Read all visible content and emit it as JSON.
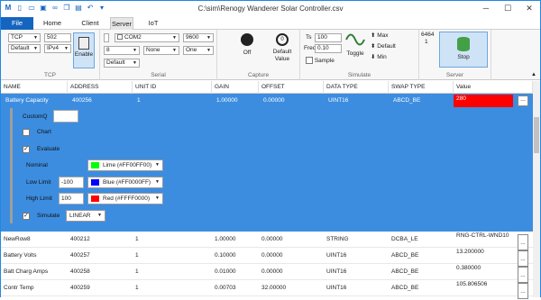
{
  "window": {
    "title": "C:\\sim\\Renogy Wanderer Solar Controller.csv"
  },
  "tabs": [
    {
      "label": "File"
    },
    {
      "label": "Home"
    },
    {
      "label": "Client"
    },
    {
      "label": "Server"
    },
    {
      "label": "IoT"
    }
  ],
  "tcp": {
    "protocol": "TCP",
    "port": "502",
    "mode": "Default",
    "ip": "IPv4",
    "enable": "Enable",
    "group": "TCP"
  },
  "serial": {
    "com": "COM2",
    "baud": "9600",
    "bits": "8",
    "parity": "None",
    "stop": "One",
    "flow": "Default",
    "group": "Serial"
  },
  "capture": {
    "off": "Off",
    "default_value": "Default\nValue",
    "group": "Capture"
  },
  "simulate": {
    "ts_label": "Ts",
    "ts": "100",
    "freq_label": "Freq",
    "freq": "0.10",
    "sample": "Sample",
    "toggle": "Toggle",
    "max": "Max",
    "default": "Default",
    "min": "Min",
    "group": "Simulate"
  },
  "server": {
    "count_top": "6464",
    "count_bottom": "1",
    "stop": "Stop",
    "group": "Server"
  },
  "grid": {
    "headers": [
      "NAME",
      "ADDRESS",
      "UNIT ID",
      "GAIN",
      "OFFSET",
      "DATA TYPE",
      "SWAP TYPE",
      "Value"
    ],
    "selected": {
      "name": "Battery Capacity",
      "address": "400256",
      "unit": "1",
      "gain": "1.00000",
      "offset": "0.00000",
      "dtype": "UINT16",
      "swap": "ABCD_BE",
      "value": "280",
      "edit": "..."
    },
    "detail": {
      "customq": "CustomQ",
      "chart": "Chart",
      "evaluate": "Evaluate",
      "nominal": "Nominal",
      "nominal_color": "Lime (#FF00FF00)",
      "low": "Low Limit",
      "low_val": "-100",
      "low_color": "Blue (#FF0000FF)",
      "high": "High Limit",
      "high_val": "100",
      "high_color": "Red (#FFFF0000)",
      "simulate": "Simulate",
      "sim_mode": "LINEAR"
    },
    "rows": [
      {
        "name": "NewRow8",
        "address": "400212",
        "unit": "1",
        "gain": "1.00000",
        "offset": "0.00000",
        "dtype": "STRING",
        "swap": "DCBA_LE",
        "value": "RNG-CTRL-WND10",
        "edit": "..."
      },
      {
        "name": "Battery Volts",
        "address": "400257",
        "unit": "1",
        "gain": "0.10000",
        "offset": "0.00000",
        "dtype": "UINT16",
        "swap": "ABCD_BE",
        "value": "13.200000",
        "edit": "..."
      },
      {
        "name": "Batt Charg Amps",
        "address": "400258",
        "unit": "1",
        "gain": "0.01000",
        "offset": "0.00000",
        "dtype": "UINT16",
        "swap": "ABCD_BE",
        "value": "0.380000",
        "edit": "..."
      },
      {
        "name": "Contr Temp",
        "address": "400259",
        "unit": "1",
        "gain": "0.00703",
        "offset": "32.00000",
        "dtype": "UINT16",
        "swap": "ABCD_BE",
        "value": "105.806506",
        "edit": "..."
      }
    ]
  },
  "colors": {
    "accent": "#1565c0",
    "selection": "#3c8de0",
    "value_bg": "#ff0000",
    "stop_green": "#43a047",
    "lime": "#00ff00",
    "blue": "#0000ff",
    "red": "#ff0000"
  }
}
